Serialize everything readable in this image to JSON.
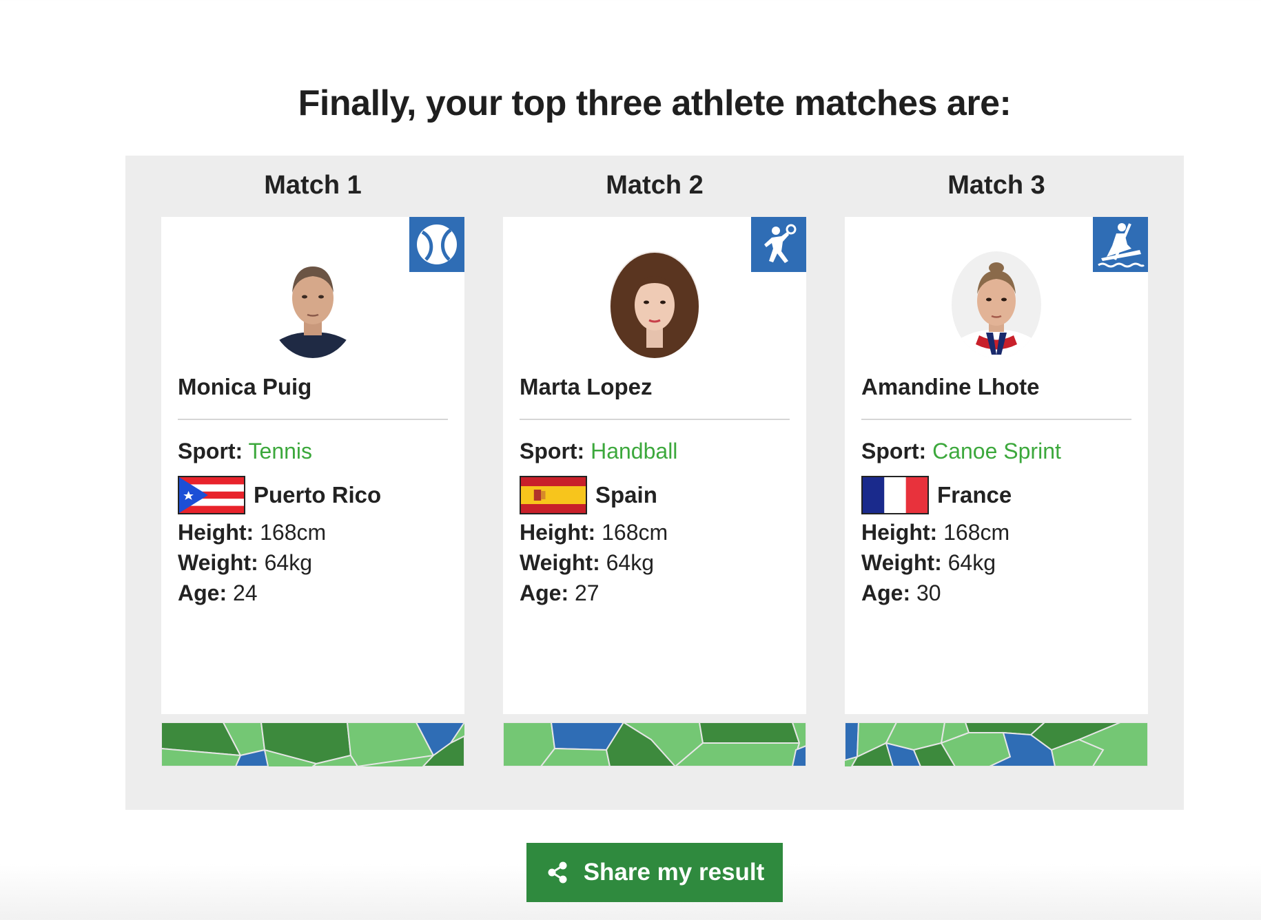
{
  "page": {
    "title": "Finally, your top three athlete matches are:"
  },
  "matches": [
    {
      "heading": "Match 1",
      "sport_icon": "tennis-ball-icon",
      "name": "Monica Puig",
      "sport_label": "Sport:",
      "sport": "Tennis",
      "country": "Puerto Rico",
      "flag": "puerto-rico-flag",
      "height_label": "Height:",
      "height": "168cm",
      "weight_label": "Weight:",
      "weight": "64kg",
      "age_label": "Age:",
      "age": "24"
    },
    {
      "heading": "Match 2",
      "sport_icon": "handball-player-icon",
      "name": "Marta Lopez",
      "sport_label": "Sport:",
      "sport": "Handball",
      "country": "Spain",
      "flag": "spain-flag",
      "height_label": "Height:",
      "height": "168cm",
      "weight_label": "Weight:",
      "weight": "64kg",
      "age_label": "Age:",
      "age": "27"
    },
    {
      "heading": "Match 3",
      "sport_icon": "canoe-paddler-icon",
      "name": "Amandine Lhote",
      "sport_label": "Sport:",
      "sport": "Canoe Sprint",
      "country": "France",
      "flag": "france-flag",
      "height_label": "Height:",
      "height": "168cm",
      "weight_label": "Weight:",
      "weight": "64kg",
      "age_label": "Age:",
      "age": "30"
    }
  ],
  "share": {
    "label": "Share my result",
    "icon": "share-icon"
  },
  "colors": {
    "accent_green": "#3ca83c",
    "button_green": "#2f8a3e",
    "icon_blue": "#2f6db5",
    "panel_grey": "#ededed"
  }
}
